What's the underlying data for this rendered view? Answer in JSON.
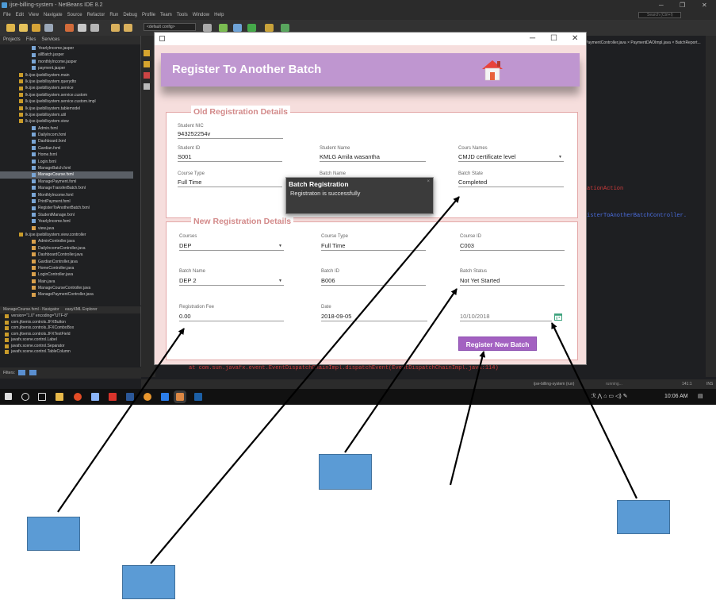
{
  "ide": {
    "window_title": "ijse-billing-system - NetBeans IDE 8.2",
    "menu": [
      "File",
      "Edit",
      "View",
      "Navigate",
      "Source",
      "Refactor",
      "Run",
      "Debug",
      "Profile",
      "Team",
      "Tools",
      "Window",
      "Help"
    ],
    "search_placeholder": "Search (Ctrl+I)",
    "config_value": "<default config>",
    "panel_tabs": [
      "Projects",
      "Files",
      "Services"
    ],
    "tree": [
      {
        "label": "YearlyIncome.jasper",
        "type": "file"
      },
      {
        "label": "allBatch.jasper",
        "type": "file"
      },
      {
        "label": "monthlyIncome.jasper",
        "type": "file"
      },
      {
        "label": "payment.jasper",
        "type": "file"
      },
      {
        "label": "lk.ijse.ijsebillsystem.main",
        "type": "pkg"
      },
      {
        "label": "lk.ijse.ijsebillsystem.querydto",
        "type": "pkg"
      },
      {
        "label": "lk.ijse.ijsebillsystem.service",
        "type": "pkg"
      },
      {
        "label": "lk.ijse.ijsebillsystem.service.custom",
        "type": "pkg"
      },
      {
        "label": "lk.ijse.ijsebillsystem.service.custom.impl",
        "type": "pkg"
      },
      {
        "label": "lk.ijse.ijsebillsystem.tablemodel",
        "type": "pkg"
      },
      {
        "label": "lk.ijse.ijsebillsystem.util",
        "type": "pkg"
      },
      {
        "label": "lk.ijse.ijsebillsystem.view",
        "type": "pkg"
      },
      {
        "label": "Admin.fxml",
        "type": "file"
      },
      {
        "label": "DailyIncom.fxml",
        "type": "file"
      },
      {
        "label": "Dashboard.fxml",
        "type": "file"
      },
      {
        "label": "Gardian.fxml",
        "type": "file"
      },
      {
        "label": "Home.fxml",
        "type": "file"
      },
      {
        "label": "Login.fxml",
        "type": "file"
      },
      {
        "label": "ManageBatch.fxml",
        "type": "file"
      },
      {
        "label": "ManageCourse.fxml",
        "type": "file",
        "selected": true
      },
      {
        "label": "ManagePayment.fxml",
        "type": "file"
      },
      {
        "label": "ManageTransferBatch.fxml",
        "type": "file"
      },
      {
        "label": "MonthlyIncome.fxml",
        "type": "file"
      },
      {
        "label": "PrintPayment.fxml",
        "type": "file"
      },
      {
        "label": "RegisterToAnotherBatch.fxml",
        "type": "file"
      },
      {
        "label": "StudentManage.fxml",
        "type": "file"
      },
      {
        "label": "YearlyIncome.fxml",
        "type": "file"
      },
      {
        "label": "view.java",
        "type": "java"
      },
      {
        "label": "lk.ijse.ijsebillsystem.view.controller",
        "type": "pkg"
      },
      {
        "label": "AdminController.java",
        "type": "java"
      },
      {
        "label": "DailyIncomeController.java",
        "type": "java"
      },
      {
        "label": "DashboardController.java",
        "type": "java"
      },
      {
        "label": "GardianController.java",
        "type": "java"
      },
      {
        "label": "HomeController.java",
        "type": "java"
      },
      {
        "label": "LoginController.java",
        "type": "java"
      },
      {
        "label": "Main.java",
        "type": "java"
      },
      {
        "label": "ManageCourseController.java",
        "type": "java"
      },
      {
        "label": "ManagePaymentController.java",
        "type": "java"
      }
    ],
    "navigator_title": "ManageCourse.fxml - Navigator",
    "navigator_filter": "easyXML Explorer",
    "navigator_items": [
      "version=\"1.0\" encoding=\"UTF-8\"",
      "com.jfoenix.controls.JFXButton",
      "com.jfoenix.controls.JFXComboBox",
      "com.jfoenix.controls.JFXTextField",
      "javafx.scene.control.Label",
      "javafx.scene.control.Separator",
      "javafx.scene.control.TableColumn"
    ],
    "filters_label": "Filters:",
    "editor_tabs": "PaymentController.java  ×  PaymentDAOImpl.java  ×  BatchReport...",
    "code_lines": [
      {
        "text": "ationAction",
        "color": "#cc3b3b"
      },
      {
        "text": "isterToAnotherBatchController.",
        "color": "#4b6ee0"
      },
      {
        "text": "at com.sun.javafx.event.EventDispatchChainImpl.dispatchEvent(EventDispatchChainImpl.java:114)",
        "color": "#cc3b3b"
      }
    ],
    "status_project": "ijse-billing-system (run)",
    "status_running": "running...",
    "status_position": "141:1",
    "status_mode": "INS",
    "taskbar_time": "10:06 AM"
  },
  "dialog": {
    "header_title": "Register To Another Batch",
    "old_section": {
      "legend": "Old Registration Details",
      "student_nic_label": "Student NIC",
      "student_nic": "943252254v",
      "student_id_label": "Student ID",
      "student_id": "S001",
      "student_name_label": "Student Name",
      "student_name": "KMLG Amila wasantha",
      "cours_names_label": "Cours Names",
      "cours_names": "CMJD certificate level",
      "course_type_label": "Course Type",
      "course_type": "Full Time",
      "batch_name_label": "Batch Name",
      "batch_state_label": "Batch State",
      "batch_state": "Completed"
    },
    "new_section": {
      "legend": "New Registration Details",
      "courses_label": "Courses",
      "courses": "DEP",
      "course_type_label": "Course Type",
      "course_type": "Full Time",
      "course_id_label": "Course ID",
      "course_id": "C003",
      "batch_name_label": "Batch Name",
      "batch_name": "DEP 2",
      "batch_id_label": "Batch ID",
      "batch_id": "B006",
      "batch_status_label": "Batch Status",
      "batch_status": "Not Yet Started",
      "reg_fee_label": "Registration Fee",
      "reg_fee": "0.00",
      "date_label": "Date",
      "date": "2018-09-05",
      "picker_date": "10/10/2018"
    },
    "register_button": "Register New Batch",
    "toast": {
      "title": "Batch Registration",
      "message": "Registraton is successfully",
      "close": "×"
    }
  },
  "colors": {
    "header": "#bf96d0",
    "button": "#a361c1",
    "legend": "#d38a8a",
    "annotation_box": "#5b9bd5"
  }
}
